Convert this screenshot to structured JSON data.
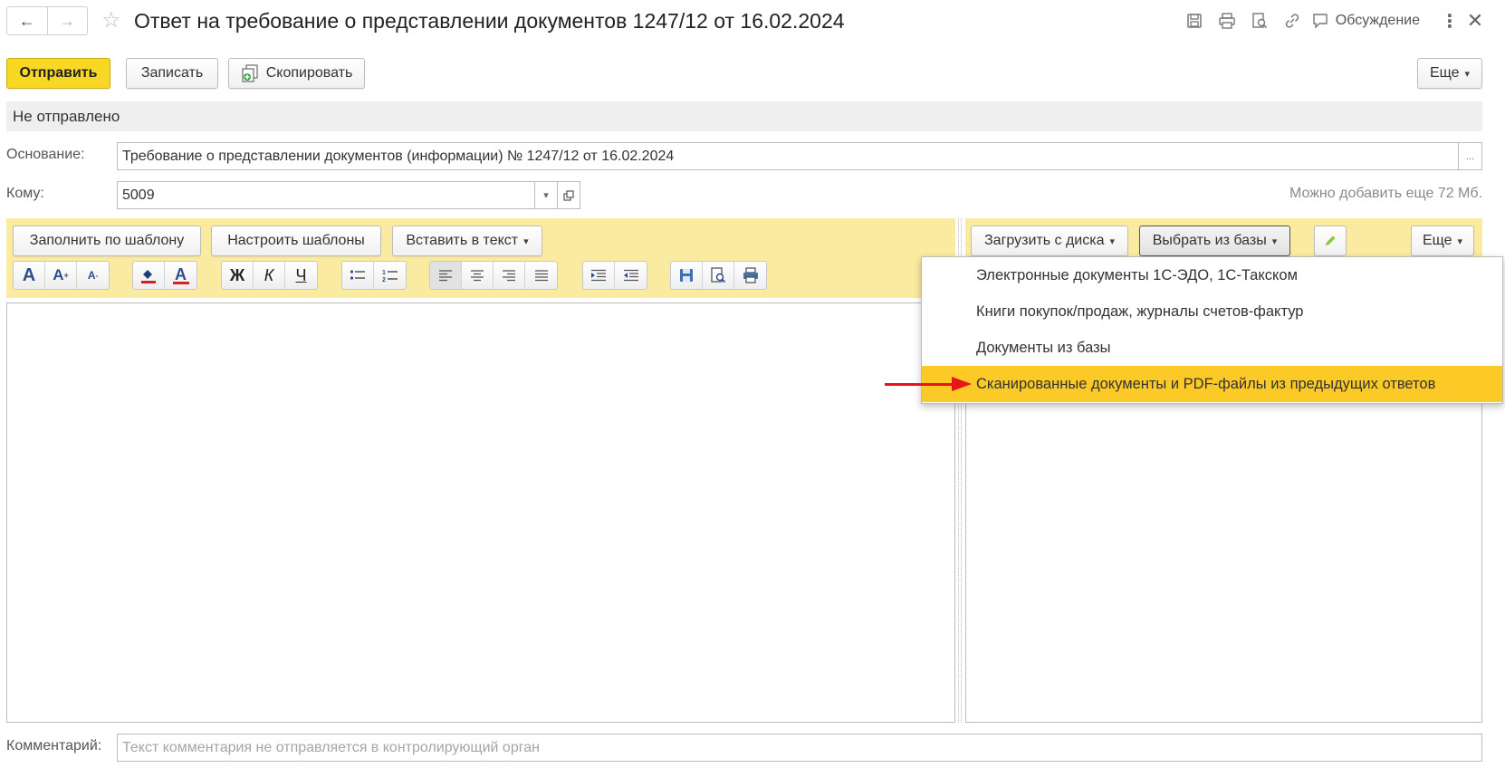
{
  "window": {
    "title": "Ответ на требование о представлении документов 1247/12 от 16.02.2024",
    "discuss_label": "Обсуждение"
  },
  "toolbar": {
    "send_label": "Отправить",
    "save_label": "Записать",
    "copy_label": "Скопировать",
    "more_label": "Еще"
  },
  "status": "Не отправлено",
  "form": {
    "basis_label": "Основание:",
    "basis_value": "Требование о представлении документов (информации) № 1247/12 от 16.02.2024",
    "to_label": "Кому:",
    "to_value": "5009",
    "size_hint": "Можно добавить еще 72 Мб.",
    "comment_label": "Комментарий:",
    "comment_placeholder": "Текст комментария не отправляется в контролирующий орган"
  },
  "editor_toolbar": {
    "fill_template": "Заполнить по шаблону",
    "setup_templates": "Настроить шаблоны",
    "insert_text": "Вставить в текст",
    "bold": "Ж",
    "italic": "К",
    "underline": "Ч"
  },
  "attachments_toolbar": {
    "load_from_disk": "Загрузить с диска",
    "choose_from_base": "Выбрать из базы",
    "more_label": "Еще"
  },
  "dropdown": {
    "items": [
      "Электронные документы 1С-ЭДО, 1С-Такском",
      "Книги покупок/продаж, журналы счетов-фактур",
      "Документы из базы",
      "Сканированные документы и PDF-файлы из предыдущих ответов"
    ],
    "highlighted_index": 3
  },
  "colors": {
    "accent_yellow": "#f8d825",
    "panel_yellow": "#fbeba0",
    "highlight": "#fbca27",
    "annotation_arrow": "#e8141b"
  }
}
